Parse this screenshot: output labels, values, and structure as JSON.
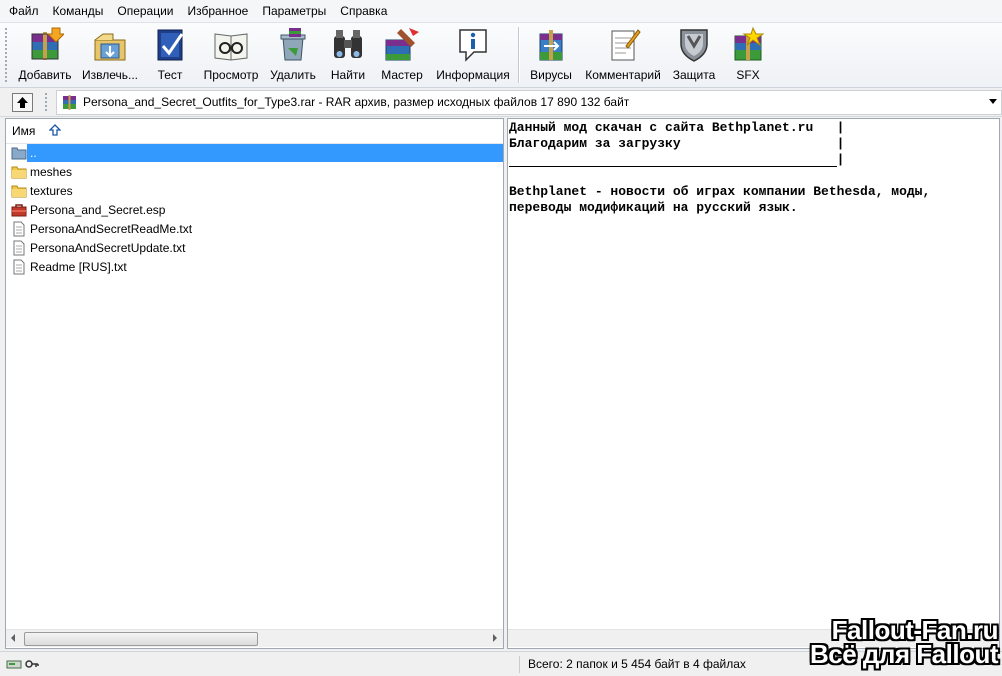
{
  "menu": [
    "Файл",
    "Команды",
    "Операции",
    "Избранное",
    "Параметры",
    "Справка"
  ],
  "toolbar": [
    {
      "label": "Добавить",
      "icon": "add-archive-icon"
    },
    {
      "label": "Извлечь...",
      "icon": "extract-icon"
    },
    {
      "label": "Тест",
      "icon": "test-icon"
    },
    {
      "label": "Просмотр",
      "icon": "view-icon"
    },
    {
      "label": "Удалить",
      "icon": "delete-icon"
    },
    {
      "label": "Найти",
      "icon": "find-binoculars-icon"
    },
    {
      "label": "Мастер",
      "icon": "wizard-icon"
    },
    {
      "label": "Информация",
      "icon": "info-icon"
    },
    {
      "label": "Вирусы",
      "icon": "virus-scan-icon"
    },
    {
      "label": "Комментарий",
      "icon": "comment-icon"
    },
    {
      "label": "Защита",
      "icon": "protect-shield-icon"
    },
    {
      "label": "SFX",
      "icon": "sfx-icon"
    }
  ],
  "address": {
    "text": "Persona_and_Secret_Outfits_for_Type3.rar - RAR архив, размер исходных файлов 17 890 132 байт"
  },
  "list": {
    "column_name": "Имя",
    "items": [
      {
        "name": "..",
        "type": "parent",
        "selected": true
      },
      {
        "name": "meshes",
        "type": "folder"
      },
      {
        "name": "textures",
        "type": "folder"
      },
      {
        "name": "Persona_and_Secret.esp",
        "type": "esp"
      },
      {
        "name": "PersonaAndSecretReadMe.txt",
        "type": "txt"
      },
      {
        "name": "PersonaAndSecretUpdate.txt",
        "type": "txt"
      },
      {
        "name": "Readme [RUS].txt",
        "type": "txt"
      }
    ]
  },
  "preview": {
    "line1": "Данный мод скачан с сайта Bethplanet.ru   |",
    "line2": "Благодарим за загрузку                    |",
    "line3": "                                          |",
    "line4": "Bethplanet - новости об играх компании Bethesda, моды,",
    "line5": "переводы модификаций на русский язык."
  },
  "status": {
    "text": "Всего: 2 папок и 5 454 байт в 4 файлах"
  },
  "watermark": {
    "line1": "Fallout-Fan.ru",
    "line2": "Всё для Fallout"
  }
}
